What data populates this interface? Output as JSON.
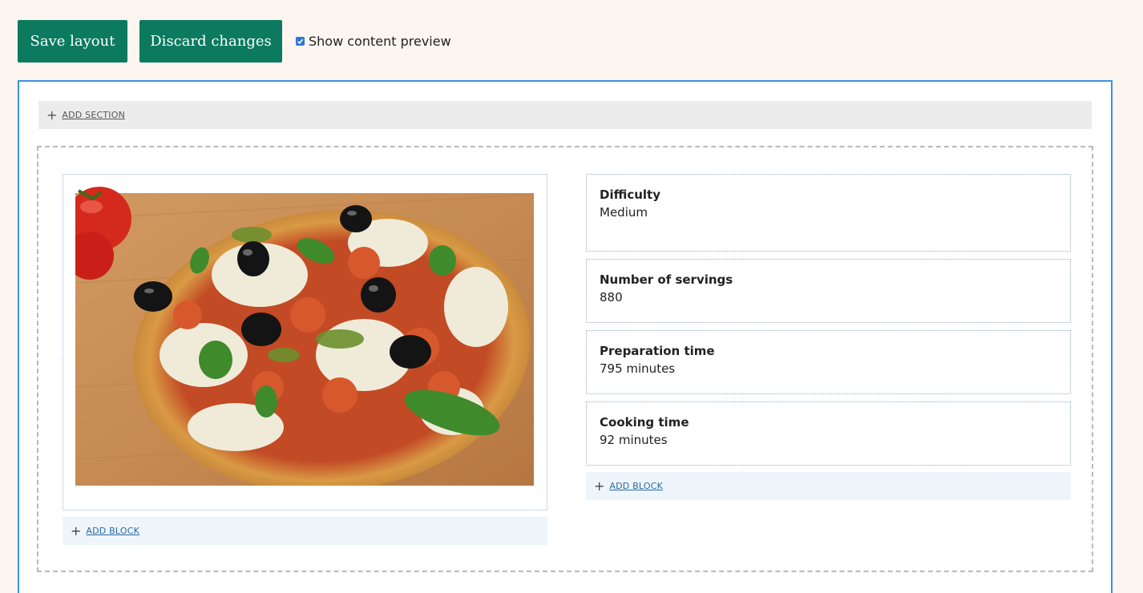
{
  "toolbar": {
    "save_label": "Save layout",
    "discard_label": "Discard changes",
    "preview_label": "Show content preview",
    "preview_checked": true
  },
  "layout": {
    "add_section_label": "ADD SECTION",
    "image_alt": "Pizza with olives, basil, mozzarella and tomatoes",
    "first_region_add_block": "ADD BLOCK",
    "second_region_add_block": "ADD BLOCK",
    "fields": [
      {
        "label": "Difficulty",
        "value": "Medium"
      },
      {
        "label": "Number of servings",
        "value": "880"
      },
      {
        "label": "Preparation time",
        "value": "795 minutes"
      },
      {
        "label": "Cooking time",
        "value": "92 minutes"
      }
    ]
  },
  "colors": {
    "accent": "#0b7a5f",
    "canvas_border": "#3d91de",
    "background": "#fcf5f0"
  },
  "icons": [
    "plus-icon",
    "checkbox-check-icon"
  ]
}
